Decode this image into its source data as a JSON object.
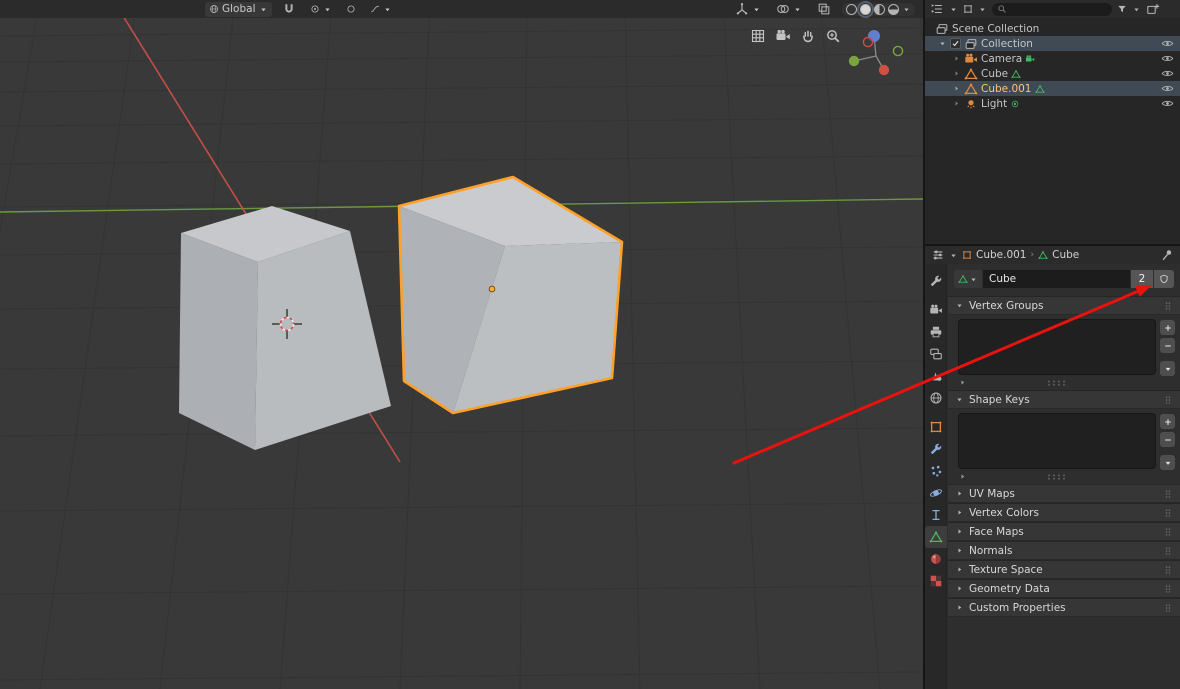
{
  "viewport": {
    "header": {
      "orientation": "Global"
    },
    "shading_modes": [
      "wireframe",
      "solid",
      "material-preview",
      "rendered"
    ],
    "overlay_buttons": [
      "orthographic-grid",
      "camera-view",
      "pan-hand",
      "zoom"
    ]
  },
  "outliner": {
    "search": {
      "placeholder": ""
    },
    "rows": [
      {
        "label": "Scene Collection"
      },
      {
        "label": "Collection"
      },
      {
        "label": "Camera"
      },
      {
        "label": "Cube"
      },
      {
        "label": "Cube.001"
      },
      {
        "label": "Light"
      }
    ]
  },
  "properties": {
    "breadcrumb": {
      "object": "Cube.001",
      "data": "Cube"
    },
    "id_block": {
      "name": "Cube",
      "users": "2"
    },
    "panels": [
      {
        "label": "Vertex Groups",
        "expanded": true
      },
      {
        "label": "Shape Keys",
        "expanded": true
      },
      {
        "label": "UV Maps",
        "expanded": false
      },
      {
        "label": "Vertex Colors",
        "expanded": false
      },
      {
        "label": "Face Maps",
        "expanded": false
      },
      {
        "label": "Normals",
        "expanded": false
      },
      {
        "label": "Texture Space",
        "expanded": false
      },
      {
        "label": "Geometry Data",
        "expanded": false
      },
      {
        "label": "Custom Properties",
        "expanded": false
      }
    ],
    "tabs": [
      "tool",
      "render",
      "output",
      "view-layer",
      "scene",
      "world",
      "object",
      "modifiers",
      "particles",
      "physics",
      "constraints",
      "object-data",
      "material",
      "texture"
    ],
    "active_tab": "object-data"
  },
  "colors": {
    "selection_outline": "#ffa028",
    "axis_x": "#c9504a",
    "axis_y": "#6d9e3f",
    "annotation_arrow": "#e8120e",
    "active_object_text": "#ffc46f",
    "data_green": "#46b962",
    "object_orange": "#e0883f"
  }
}
